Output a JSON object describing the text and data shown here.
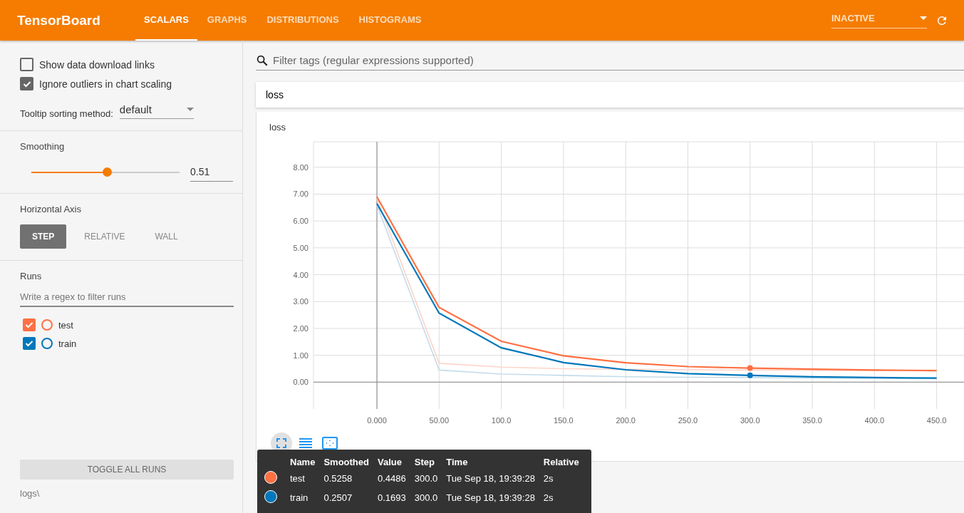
{
  "header": {
    "title": "TensorBoard",
    "tabs": [
      {
        "label": "SCALARS",
        "selected": true
      },
      {
        "label": "GRAPHS",
        "selected": false
      },
      {
        "label": "DISTRIBUTIONS",
        "selected": false
      },
      {
        "label": "HISTOGRAMS",
        "selected": false
      }
    ],
    "run_status": "INACTIVE"
  },
  "sidebar": {
    "options": [
      {
        "label": "Show data download links",
        "checked": false
      },
      {
        "label": "Ignore outliers in chart scaling",
        "checked": true
      }
    ],
    "tooltip_sorting": {
      "label": "Tooltip sorting method:",
      "value": "default"
    },
    "smoothing": {
      "label": "Smoothing",
      "level": 0.51,
      "value": "0.51"
    },
    "horizontal_axis": {
      "label": "Horizontal Axis",
      "options": [
        {
          "label": "STEP",
          "selected": true
        },
        {
          "label": "RELATIVE",
          "selected": false
        },
        {
          "label": "WALL",
          "selected": false
        }
      ]
    },
    "runs": {
      "label": "Runs",
      "placeholder": "Write a regex to filter runs",
      "items": [
        {
          "name": "test",
          "checked": true,
          "color": "#ff7043"
        },
        {
          "name": "train",
          "checked": true,
          "color": "#0077bb"
        }
      ]
    },
    "toggle_button": "TOGGLE ALL RUNS",
    "log_dir": "logs\\"
  },
  "main": {
    "filter_placeholder": "Filter tags (regular expressions supported)",
    "category": "loss",
    "chart_data": {
      "type": "line",
      "title": "loss",
      "grid": true,
      "x": [
        0,
        50,
        100,
        150,
        200,
        250,
        300,
        350,
        400,
        450
      ],
      "xlim": [
        -51,
        472
      ],
      "ylim": [
        -1,
        8.95
      ],
      "xticks": [
        {
          "value": 0,
          "label": "0.000"
        },
        {
          "value": 50,
          "label": "50.00"
        },
        {
          "value": 100,
          "label": "100.0"
        },
        {
          "value": 150,
          "label": "150.0"
        },
        {
          "value": 200,
          "label": "200.0"
        },
        {
          "value": 250,
          "label": "250.0"
        },
        {
          "value": 300,
          "label": "300.0"
        },
        {
          "value": 350,
          "label": "350.0"
        },
        {
          "value": 400,
          "label": "400.0"
        },
        {
          "value": 450,
          "label": "450.0"
        }
      ],
      "yticks": [
        {
          "value": 0,
          "label": "0.00"
        },
        {
          "value": 1,
          "label": "1.00"
        },
        {
          "value": 2,
          "label": "2.00"
        },
        {
          "value": 3,
          "label": "3.00"
        },
        {
          "value": 4,
          "label": "4.00"
        },
        {
          "value": 5,
          "label": "5.00"
        },
        {
          "value": 6,
          "label": "6.00"
        },
        {
          "value": 7,
          "label": "7.00"
        },
        {
          "value": 8,
          "label": "8.00"
        }
      ],
      "series": [
        {
          "color": "#fdd5c8",
          "values": [
            6.85,
            0.7,
            0.56,
            0.5,
            0.48,
            0.46,
            0.45,
            0.44,
            0.43,
            0.42
          ]
        },
        {
          "color": "#c4dcea",
          "values": [
            6.6,
            0.45,
            0.3,
            0.25,
            0.2,
            0.18,
            0.17,
            0.15,
            0.14,
            0.13
          ]
        },
        {
          "color": "#ff7043",
          "values": [
            6.9,
            2.78,
            1.52,
            0.98,
            0.72,
            0.58,
            0.52,
            0.48,
            0.45,
            0.43
          ]
        },
        {
          "color": "#0077bb",
          "values": [
            6.65,
            2.57,
            1.28,
            0.73,
            0.46,
            0.32,
            0.25,
            0.2,
            0.17,
            0.15
          ]
        }
      ]
    },
    "tooltip": {
      "columns": [
        "Name",
        "Smoothed",
        "Value",
        "Step",
        "Time",
        "Relative"
      ],
      "rows": [
        {
          "color": "#ff7043",
          "cells": [
            "test",
            "0.5258",
            "0.4486",
            "300.0",
            "Tue Sep 18, 19:39:28",
            "2s"
          ]
        },
        {
          "color": "#0077bb",
          "cells": [
            "train",
            "0.2507",
            "0.1693",
            "300.0",
            "Tue Sep 18, 19:39:28",
            "2s"
          ]
        }
      ]
    }
  }
}
